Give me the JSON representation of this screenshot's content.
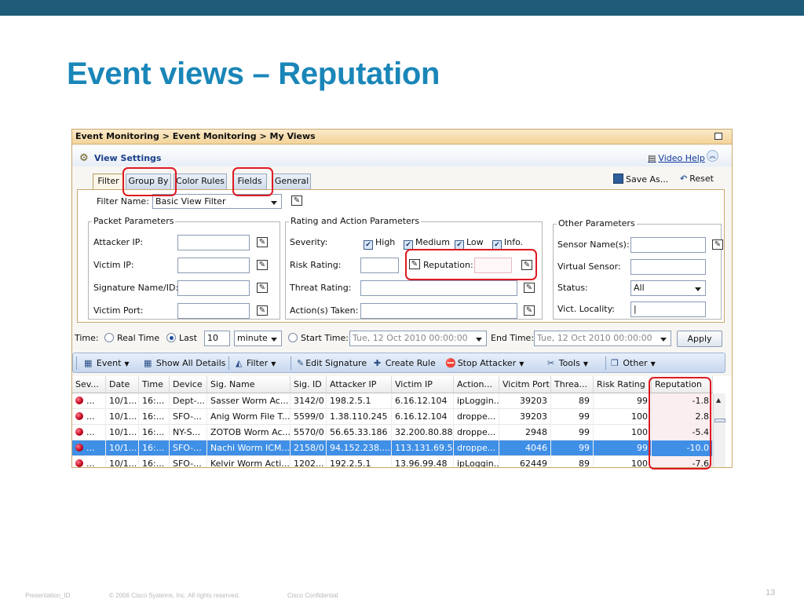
{
  "slide": {
    "title": "Event views – Reputation",
    "footer_presentation_id": "Presentation_ID",
    "footer_copyright": "© 2006 Cisco Systems, Inc. All rights reserved.",
    "footer_confidential": "Cisco Confidential",
    "page_number": "13"
  },
  "window": {
    "breadcrumb": "Event Monitoring > Event Monitoring > My Views"
  },
  "view_settings": {
    "title": "View Settings",
    "video_help": "Video Help",
    "save_as": "Save As...",
    "reset": "Reset",
    "tabs": [
      "Filter",
      "Group By",
      "Color Rules",
      "Fields",
      "General"
    ],
    "active_tab": "Filter"
  },
  "filter": {
    "filter_name_label": "Filter Name:",
    "filter_name_value": "Basic View Filter",
    "packet_parameters": {
      "title": "Packet Parameters",
      "attacker_ip": "Attacker IP:",
      "victim_ip": "Victim IP:",
      "signature": "Signature Name/ID:",
      "victim_port": "Victim Port:"
    },
    "rating_parameters": {
      "title": "Rating and Action Parameters",
      "severity": "Severity:",
      "sev_high": "High",
      "sev_medium": "Medium",
      "sev_low": "Low",
      "sev_info": "Info.",
      "risk_rating": "Risk Rating:",
      "reputation": "Reputation:",
      "threat_rating": "Threat Rating:",
      "actions_taken": "Action(s) Taken:"
    },
    "other_parameters": {
      "title": "Other Parameters",
      "sensor_names": "Sensor Name(s):",
      "virtual_sensor": "Virtual Sensor:",
      "status": "Status:",
      "status_value": "All",
      "vict_locality": "Vict. Locality:"
    }
  },
  "time": {
    "label": "Time:",
    "real_time": "Real Time",
    "last": "Last",
    "last_value": "10",
    "unit": "minute",
    "start_time_label": "Start Time:",
    "start_time_value": "Tue, 12 Oct 2010 00:00:00",
    "end_time_label": "End Time:",
    "end_time_value": "Tue, 12 Oct 2010 00:00:00",
    "apply": "Apply"
  },
  "toolbar": {
    "event": "Event",
    "show_all_details": "Show All Details",
    "filter": "Filter",
    "edit_signature": "Edit Signature",
    "create_rule": "Create Rule",
    "stop_attacker": "Stop Attacker",
    "tools": "Tools",
    "other": "Other"
  },
  "table": {
    "headers": [
      "Sev...",
      "Date",
      "Time",
      "Device",
      "Sig. Name",
      "Sig. ID",
      "Attacker IP",
      "Victim IP",
      "Action...",
      "Vicitm Port",
      "Threa...",
      "Risk Rating",
      "Reputation"
    ],
    "rows": [
      {
        "sev": "...",
        "date": "10/1...",
        "time": "16:...",
        "device": "Dept-...",
        "sig_name": "Sasser Worm Ac...",
        "sig_id": "3142/0",
        "attacker_ip": "198.2.5.1",
        "victim_ip": "6.16.12.104",
        "action": "ipLoggin...",
        "victim_port": "39203",
        "threat": "89",
        "risk": "99",
        "reputation": "-1.8"
      },
      {
        "sev": "...",
        "date": "10/1...",
        "time": "16:...",
        "device": "SFO-...",
        "sig_name": "Anig Worm File T...",
        "sig_id": "5599/0",
        "attacker_ip": "1.38.110.245",
        "victim_ip": "6.16.12.104",
        "action": "droppe...",
        "victim_port": "39203",
        "threat": "99",
        "risk": "100",
        "reputation": "2.8"
      },
      {
        "sev": "...",
        "date": "10/1...",
        "time": "16:...",
        "device": "NY-S...",
        "sig_name": "ZOTOB Worm Ac...",
        "sig_id": "5570/0",
        "attacker_ip": "56.65.33.186",
        "victim_ip": "32.200.80.88",
        "action": "droppe...",
        "victim_port": "2948",
        "threat": "99",
        "risk": "100",
        "reputation": "-5.4"
      },
      {
        "sev": "...",
        "date": "10/1...",
        "time": "16:...",
        "device": "SFO-...",
        "sig_name": "Nachi Worm ICM...",
        "sig_id": "2158/0",
        "attacker_ip": "94.152.238....",
        "victim_ip": "113.131.69.5",
        "action": "droppe...",
        "victim_port": "4046",
        "threat": "99",
        "risk": "99",
        "reputation": "-10.0"
      },
      {
        "sev": "...",
        "date": "10/1...",
        "time": "16:...",
        "device": "SFO-...",
        "sig_name": "Kelvir Worm Acti...",
        "sig_id": "1202...",
        "attacker_ip": "192.2.5.1",
        "victim_ip": "13.96.99.48",
        "action": "ipLoggin...",
        "victim_port": "62449",
        "threat": "89",
        "risk": "100",
        "reputation": "-7.6"
      }
    ],
    "selected_row": 3
  },
  "colors": {
    "header_bar": "#1f5c7a",
    "title_blue": "#1a86b8",
    "highlight_red": "#dd1a22",
    "selection_blue": "#3f8fe6"
  }
}
